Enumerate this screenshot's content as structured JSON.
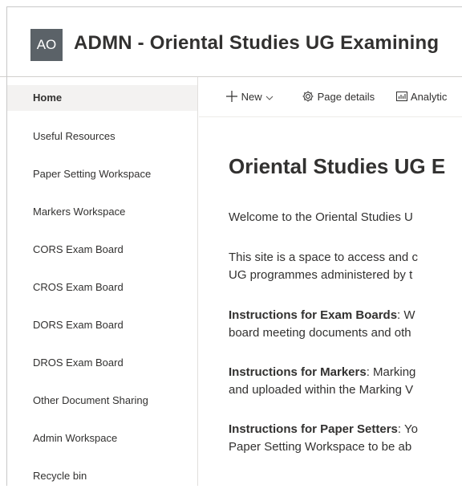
{
  "header": {
    "avatar_initials": "AO",
    "site_title": "ADMN - Oriental Studies UG Examining"
  },
  "sidebar": {
    "items": [
      {
        "label": "Home",
        "active": true
      },
      {
        "label": "Useful Resources"
      },
      {
        "label": "Paper Setting Workspace"
      },
      {
        "label": "Markers Workspace"
      },
      {
        "label": "CORS Exam Board"
      },
      {
        "label": "CROS Exam Board"
      },
      {
        "label": "DORS Exam Board"
      },
      {
        "label": "DROS Exam Board"
      },
      {
        "label": "Other Document Sharing"
      },
      {
        "label": "Admin Workspace"
      },
      {
        "label": "Recycle bin"
      }
    ]
  },
  "commandbar": {
    "new_label": "New",
    "page_details_label": "Page details",
    "analytics_label": "Analytic"
  },
  "content": {
    "heading": "Oriental Studies UG E",
    "welcome": "Welcome to the Oriental Studies U",
    "intro_line1": "This site is a space to access and c",
    "intro_line2": "UG programmes administered by t",
    "exam_boards_title": "Instructions for Exam Boards",
    "exam_boards_line1": ": W",
    "exam_boards_line2": "board meeting documents and oth",
    "markers_title": "Instructions for Markers",
    "markers_line1": ": Marking",
    "markers_line2": "and uploaded within the Marking V",
    "setters_title": "Instructions for Paper Setters",
    "setters_line1": ": Yo",
    "setters_line2": "Paper Setting Workspace to be ab"
  }
}
